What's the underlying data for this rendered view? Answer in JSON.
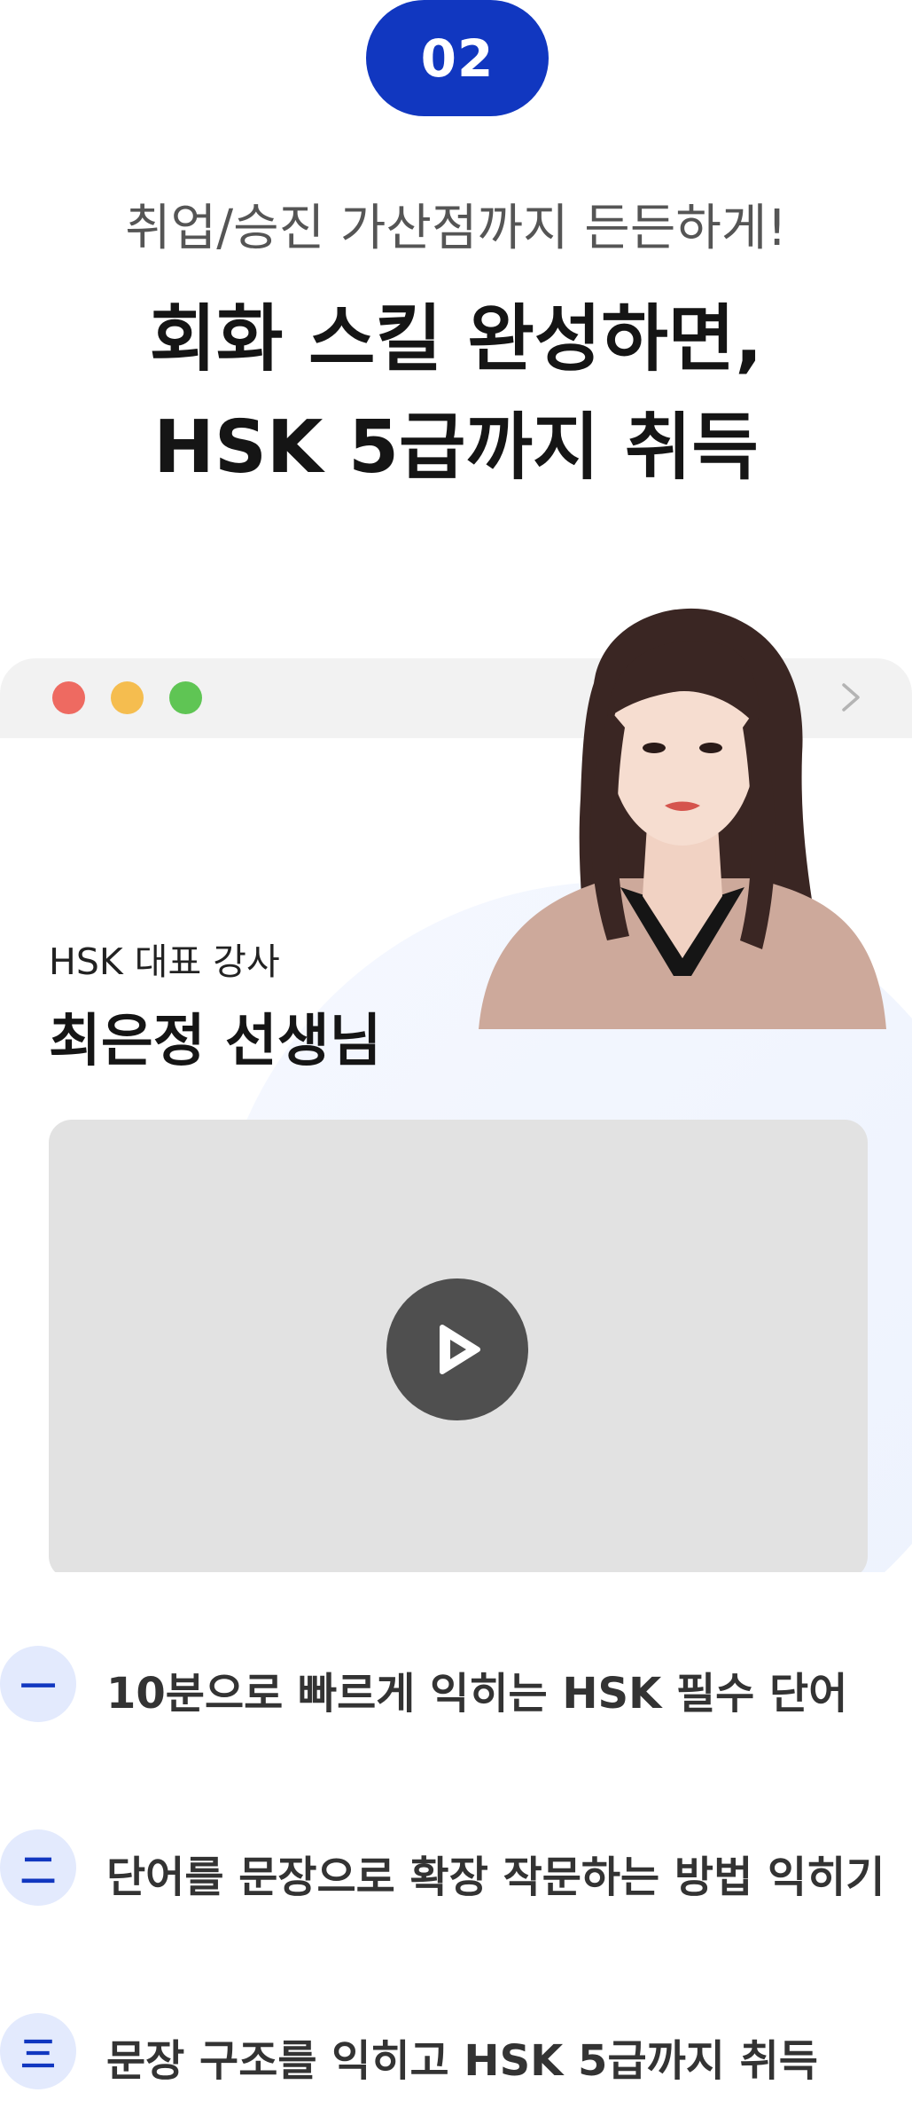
{
  "step": {
    "number": "02"
  },
  "header": {
    "kicker": "취업/승진 가산점까지 든든하게!",
    "headline_line1": "회화 스킬 완성하면,",
    "headline_line2": "HSK 5급까지 취득"
  },
  "card": {
    "window_dots": [
      "red",
      "yellow",
      "green"
    ],
    "dot_colors": {
      "red": "#ee6a61",
      "yellow": "#f5bd4f",
      "green": "#5fc554"
    },
    "nav_icon": "chevron-right-icon",
    "teacher_role": "HSK 대표 강사",
    "teacher_name": "최은정 선생님",
    "video": {
      "icon": "play-icon"
    }
  },
  "features": [
    {
      "numeral": "一",
      "text": "10분으로 빠르게 익히는 HSK 필수 단어"
    },
    {
      "numeral": "二",
      "text": "단어를 문장으로 확장 작문하는 방법 익히기"
    },
    {
      "numeral": "三",
      "text": "문장 구조를 익히고 HSK 5급까지 취득"
    }
  ],
  "colors": {
    "accent": "#1137c0",
    "accent_light": "#e3eafd"
  }
}
